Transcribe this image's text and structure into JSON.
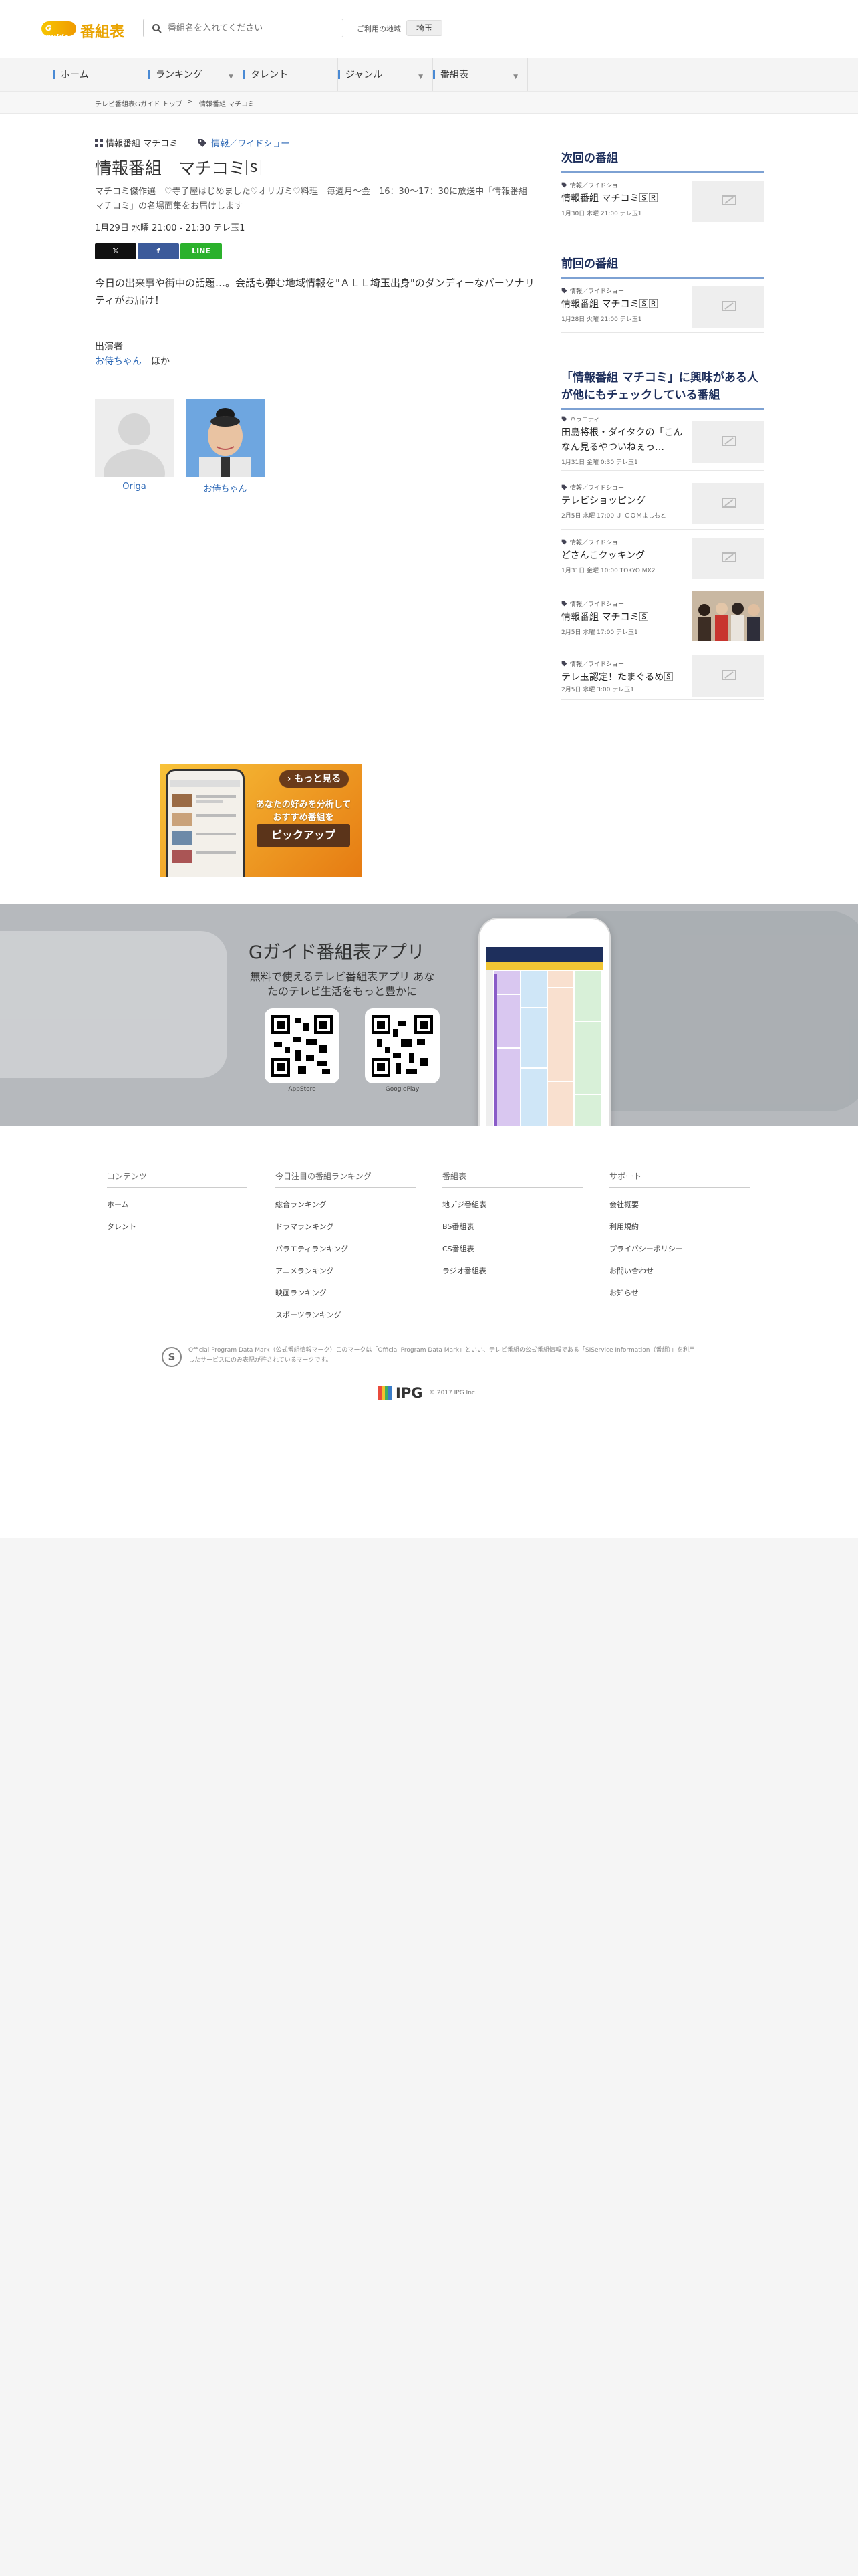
{
  "header": {
    "logo_mark": "G guide",
    "logo_text": "番組表",
    "search_placeholder": "番組名を入れてください",
    "region_label": "ご利用の地域",
    "region_value": "埼玉"
  },
  "nav": [
    "ホーム",
    "ランキング",
    "タレント",
    "ジャンル",
    "番組表"
  ],
  "breadcrumb": {
    "home": "テレビ番組表Gガイド トップ",
    "separator": ">",
    "current": "情報番組 マチコミ"
  },
  "program": {
    "series": "情報番組 マチコミ",
    "genre": "情報／ワイドショー",
    "title": "情報番組　マチコミ🅂",
    "summary_pre": "マチコミ傑作選　♡寺子屋はじめました♡オリガミ♡料理　毎週月～金　16：30～17：30に放送中「情報番組マチコミ」の名場面集をお届けします",
    "datetime": "1月29日 水曜 21:00 - 21:30 テレ玉1",
    "share": {
      "x": "𝕏",
      "facebook": "f",
      "line": "LINE"
    },
    "description": "今日の出来事や街中の話題…。会話も弾む地域情報を\"ＡＬＬ埼玉出身\"のダンディーなパーソナリティがお届け！",
    "cast_heading": "出演者",
    "cast_link": "お侍ちゃん",
    "cast_more": "ほか",
    "cast_cards": [
      "Origa",
      "お侍ちゃん"
    ]
  },
  "sidebar": {
    "next_title": "次回の番組",
    "next": {
      "genre": "情報／ワイドショー",
      "title": "情報番組 マチコミ🅂🅁",
      "time": "1月30日 木曜 21:00 テレ玉1"
    },
    "prev_title": "前回の番組",
    "prev": {
      "genre": "情報／ワイドショー",
      "title": "情報番組 マチコミ🅂🅁",
      "time": "1月28日 火曜 21:00 テレ玉1"
    },
    "related_title": "「情報番組 マチコミ」に興味がある人が他にもチェックしている番組",
    "related": [
      {
        "genre": "バラエティ",
        "title": "田島将根・ダイタクの「こんなん見るやついねぇっ…",
        "time": "1月31日 金曜 0:30 テレ玉1"
      },
      {
        "genre": "情報／ワイドショー",
        "title": "テレビショッピング",
        "time": "2月5日 水曜 17:00 Ｊ:ＣＯＭよしもと"
      },
      {
        "genre": "情報／ワイドショー",
        "title": "どさんこクッキング",
        "time": "1月31日 金曜 10:00 TOKYO MX2"
      },
      {
        "genre": "情報／ワイドショー",
        "title": "情報番組 マチコミ🅂",
        "time": "2月5日 水曜 17:00 テレ玉1"
      },
      {
        "genre": "情報／ワイドショー",
        "title": "テレ玉認定！たまぐるめ🅂",
        "time": "2月5日 水曜 3:00 テレ玉1"
      }
    ]
  },
  "ad": {
    "more": "› もっと見る",
    "message": "あなたの好みを分析して おすすめ番組を",
    "pickup": "ピックアップ"
  },
  "app_banner": {
    "title": "Gガイド番組表アプリ",
    "subtitle": "無料で使えるテレビ番組表アプリ あなたのテレビ生活をもっと豊かに",
    "appstore": "AppStore",
    "googleplay": "GooglePlay"
  },
  "footer": {
    "columns": [
      {
        "head": "コンテンツ",
        "links": [
          "ホーム",
          "タレント"
        ]
      },
      {
        "head": "今日注目の番組ランキング",
        "links": [
          "総合ランキング",
          "ドラマランキング",
          "バラエティランキング",
          "アニメランキング",
          "映画ランキング",
          "スポーツランキング"
        ]
      },
      {
        "head": "番組表",
        "links": [
          "地デジ番組表",
          "BS番組表",
          "CS番組表",
          "ラジオ番組表"
        ]
      },
      {
        "head": "サポート",
        "links": [
          "会社概要",
          "利用規約",
          "プライバシーポリシー",
          "お問い合わせ",
          "お知らせ"
        ]
      }
    ],
    "badge": "S",
    "note": "Official Program Data Mark（公式番組情報マーク）このマークは「Official Program Data Mark」といい、テレビ番組の公式番組情報である「SIService Information（番組）」を利用したサービスにのみ表記が許されているマークです。",
    "ipg": "IPG",
    "copyright": "© 2017 IPG Inc."
  },
  "colors": {
    "accent": "#2b67b5",
    "heading": "#1e2f5c",
    "rule": "#7da1d3",
    "logo": "#e9a300"
  }
}
